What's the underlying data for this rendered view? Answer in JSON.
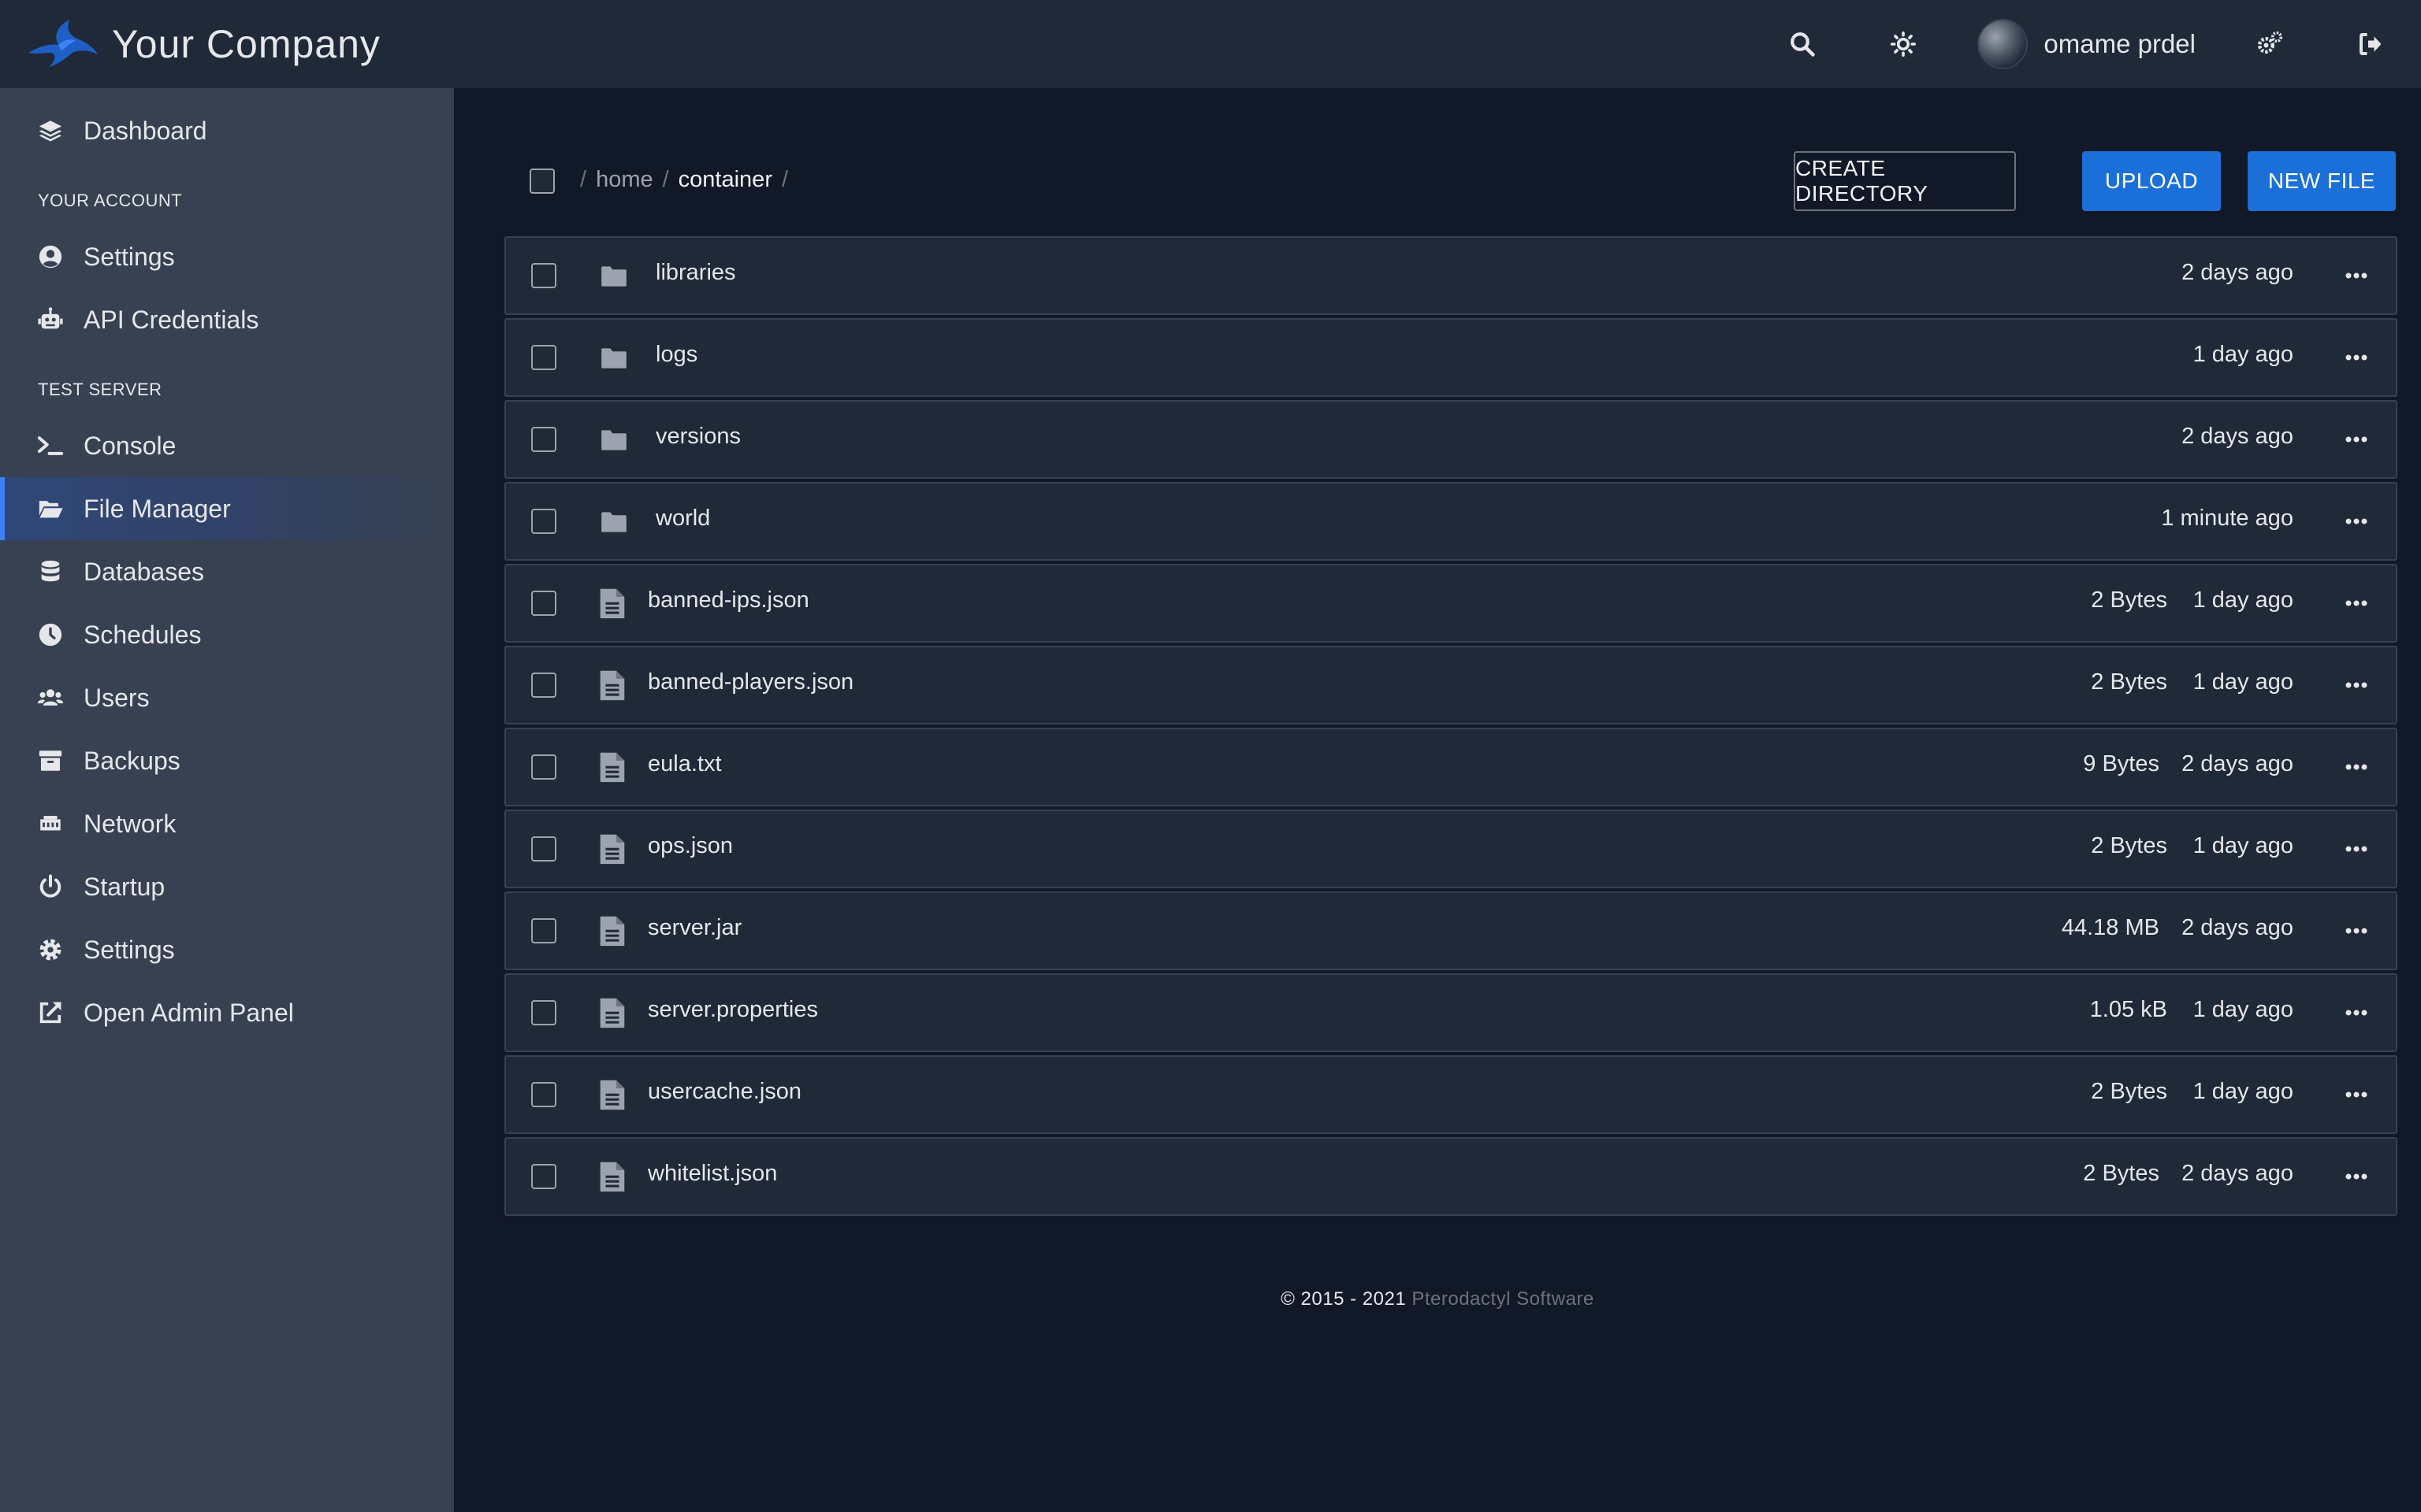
{
  "header": {
    "brand_name": "Your Company",
    "user_name": "omame prdel",
    "icons": [
      "search-icon",
      "theme-icon",
      "admin-settings-icon",
      "logout-icon"
    ]
  },
  "sidebar": {
    "dashboard": "Dashboard",
    "account_section": "YOUR ACCOUNT",
    "account_items": [
      {
        "label": "Settings",
        "icon": "user-circle-icon"
      },
      {
        "label": "API Credentials",
        "icon": "robot-icon"
      }
    ],
    "server_section": "TEST SERVER",
    "server_items": [
      {
        "label": "Console",
        "icon": "terminal-icon"
      },
      {
        "label": "File Manager",
        "icon": "folder-open-icon",
        "active": true
      },
      {
        "label": "Databases",
        "icon": "database-icon"
      },
      {
        "label": "Schedules",
        "icon": "clock-icon"
      },
      {
        "label": "Users",
        "icon": "users-icon"
      },
      {
        "label": "Backups",
        "icon": "archive-icon"
      },
      {
        "label": "Network",
        "icon": "network-icon"
      },
      {
        "label": "Startup",
        "icon": "power-icon"
      },
      {
        "label": "Settings",
        "icon": "cog-icon"
      },
      {
        "label": "Open Admin Panel",
        "icon": "external-link-icon"
      }
    ]
  },
  "breadcrumb": {
    "home": "home",
    "current": "container",
    "separator": "/"
  },
  "actions": {
    "create_directory": "CREATE DIRECTORY",
    "upload": "UPLOAD",
    "new_file": "NEW FILE"
  },
  "files": [
    {
      "name": "libraries",
      "type": "directory",
      "size": "",
      "modified": "2 days ago"
    },
    {
      "name": "logs",
      "type": "directory",
      "size": "",
      "modified": "1 day ago"
    },
    {
      "name": "versions",
      "type": "directory",
      "size": "",
      "modified": "2 days ago"
    },
    {
      "name": "world",
      "type": "directory",
      "size": "",
      "modified": "1 minute ago"
    },
    {
      "name": "banned-ips.json",
      "type": "file",
      "size": "2 Bytes",
      "modified": "1 day ago"
    },
    {
      "name": "banned-players.json",
      "type": "file",
      "size": "2 Bytes",
      "modified": "1 day ago"
    },
    {
      "name": "eula.txt",
      "type": "file",
      "size": "9 Bytes",
      "modified": "2 days ago"
    },
    {
      "name": "ops.json",
      "type": "file",
      "size": "2 Bytes",
      "modified": "1 day ago"
    },
    {
      "name": "server.jar",
      "type": "file",
      "size": "44.18 MB",
      "modified": "2 days ago"
    },
    {
      "name": "server.properties",
      "type": "file",
      "size": "1.05 kB",
      "modified": "1 day ago"
    },
    {
      "name": "usercache.json",
      "type": "file",
      "size": "2 Bytes",
      "modified": "1 day ago"
    },
    {
      "name": "whitelist.json",
      "type": "file",
      "size": "2 Bytes",
      "modified": "2 days ago"
    }
  ],
  "footer": {
    "copyright": "© 2015 - 2021",
    "link": "Pterodactyl Software"
  },
  "colors": {
    "background": "#111827",
    "sidebar": "#374151",
    "topbar": "#1f2937",
    "accent": "#1a6fd8",
    "active_border": "#3b82f6"
  }
}
